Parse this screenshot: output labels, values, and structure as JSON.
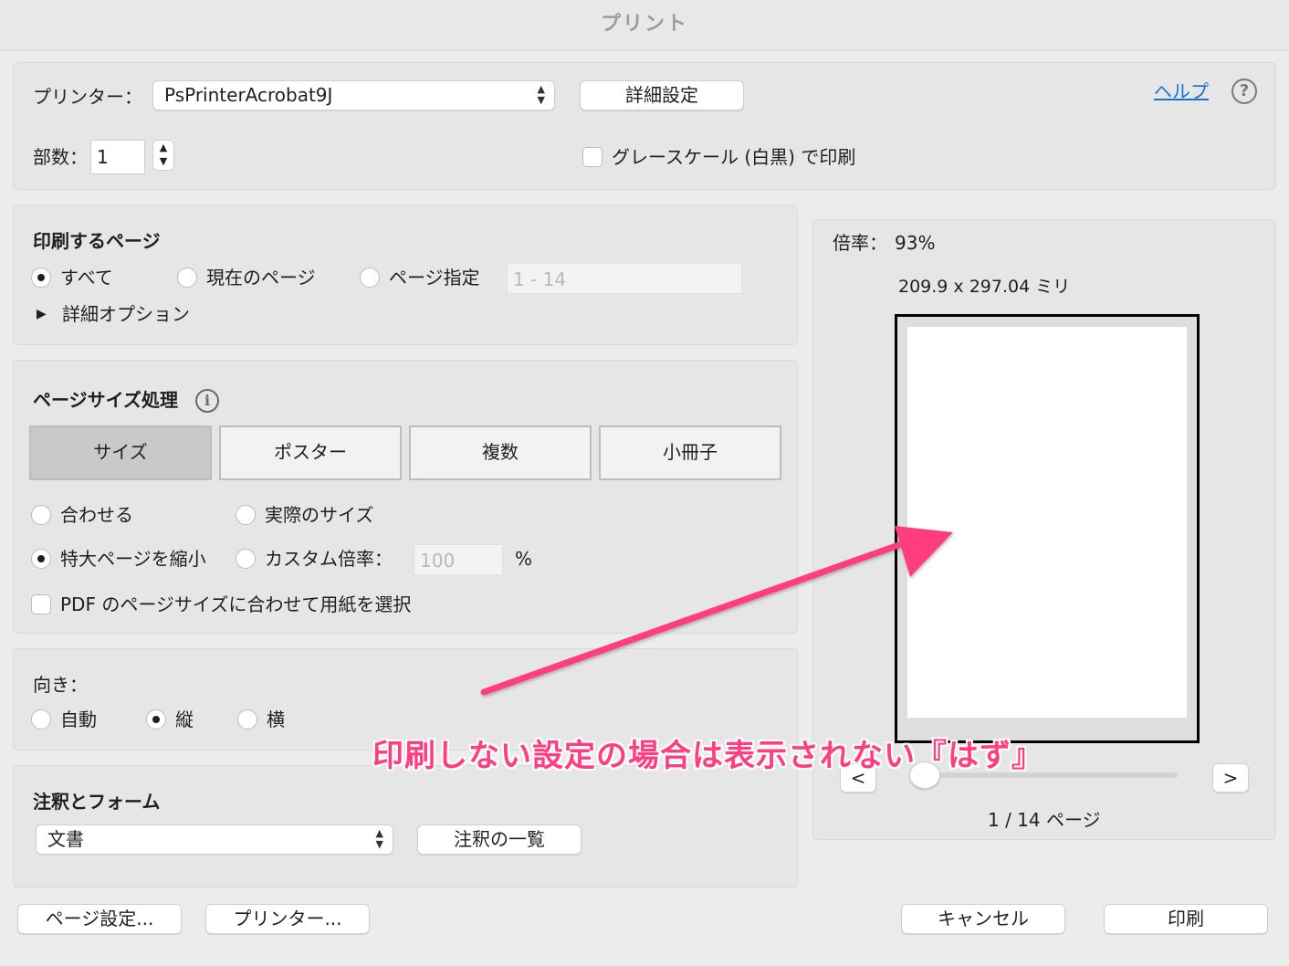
{
  "window": {
    "title": "プリント"
  },
  "printer": {
    "label": "プリンター：",
    "selected": "PsPrinterAcrobat9J",
    "details_button": "詳細設定",
    "help_link": "ヘルプ",
    "help_icon": "question-circle-icon",
    "copies_label": "部数：",
    "copies_value": "1",
    "grayscale_label": "グレースケール (白黒) で印刷",
    "grayscale_checked": false
  },
  "pages": {
    "heading": "印刷するページ",
    "options": [
      {
        "label": "すべて",
        "selected": true
      },
      {
        "label": "現在のページ",
        "selected": false
      },
      {
        "label": "ページ指定",
        "selected": false
      }
    ],
    "range_placeholder": "1 - 14",
    "more_options": "詳細オプション"
  },
  "page_sizing": {
    "heading": "ページサイズ処理",
    "info_icon": "info-circle-icon",
    "tabs": [
      {
        "label": "サイズ",
        "active": true
      },
      {
        "label": "ポスター",
        "active": false
      },
      {
        "label": "複数",
        "active": false
      },
      {
        "label": "小冊子",
        "active": false
      }
    ],
    "options": [
      {
        "label": "合わせる",
        "selected": false
      },
      {
        "label": "実際のサイズ",
        "selected": false
      },
      {
        "label": "特大ページを縮小",
        "selected": true
      },
      {
        "label": "カスタム倍率：",
        "selected": false
      }
    ],
    "custom_scale_placeholder": "100",
    "percent_sign": "%",
    "choose_paper_label": "PDF のページサイズに合わせて用紙を選択",
    "choose_paper_checked": false
  },
  "orientation": {
    "heading": "向き：",
    "options": [
      {
        "label": "自動",
        "selected": false
      },
      {
        "label": "縦",
        "selected": true
      },
      {
        "label": "横",
        "selected": false
      }
    ]
  },
  "comments": {
    "heading": "注釈とフォーム",
    "selected": "文書",
    "summary_button": "注釈の一覧"
  },
  "preview": {
    "scale_label": "倍率：",
    "scale_value": "93%",
    "paper_size": "209.9 x 297.04 ミリ",
    "prev_label": "<",
    "next_label": ">",
    "page_indicator": "1 / 14 ページ",
    "slider_position": 0.0
  },
  "footer": {
    "page_setup": "ページ設定...",
    "printer": "プリンター...",
    "cancel": "キャンセル",
    "print": "印刷"
  },
  "annotation": {
    "text": "印刷しない設定の場合は表示されない『はず』",
    "color": "#ff3d7f"
  }
}
